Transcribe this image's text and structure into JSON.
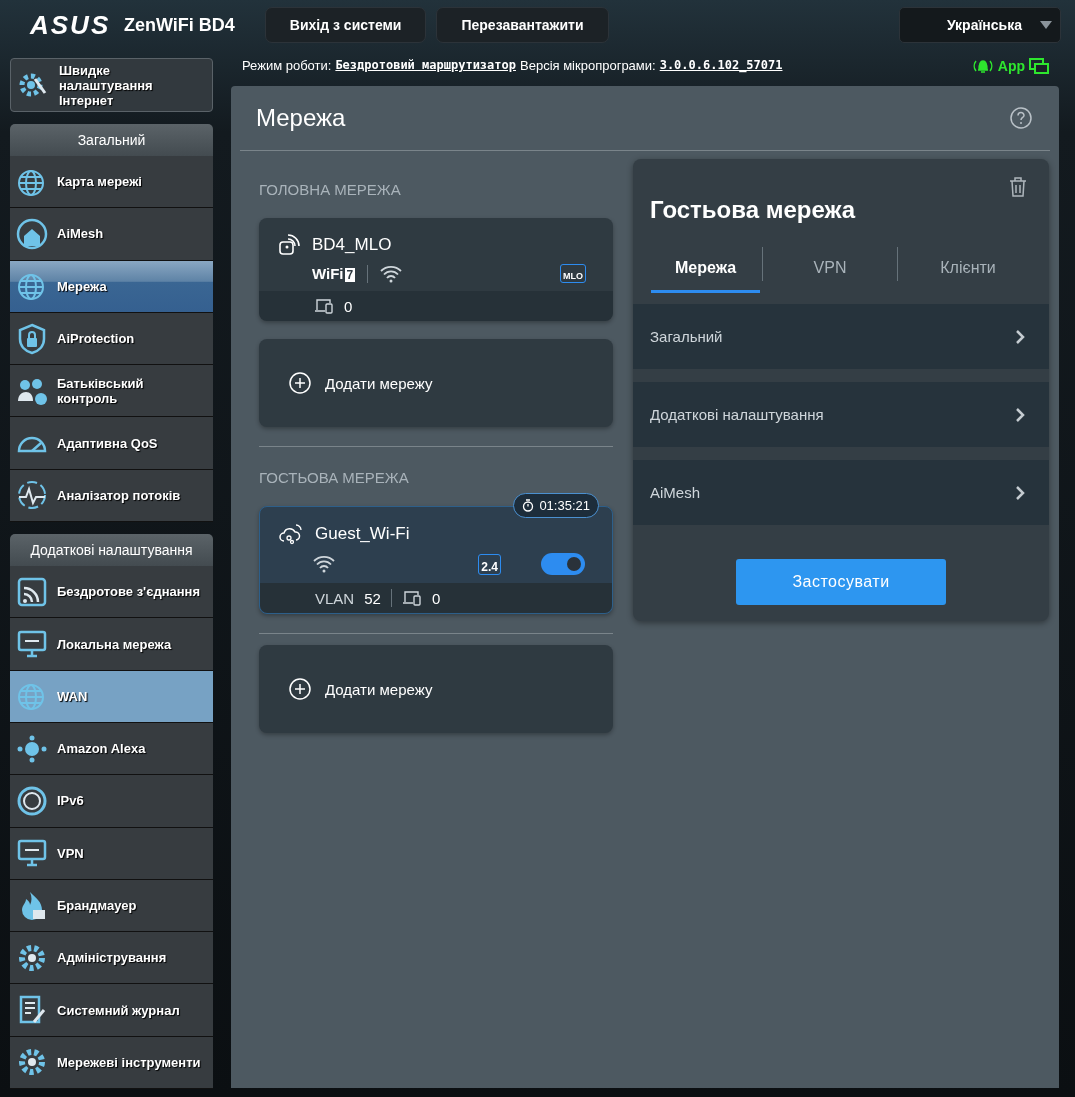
{
  "header": {
    "brand": "ASUS",
    "model": "ZenWiFi BD4",
    "buttons": [
      "Вихід з системи",
      "Перезавантажити"
    ],
    "language": "Українська"
  },
  "status_line": {
    "mode_label": "Режим роботи:",
    "mode": "Бездротовий маршрутизатор",
    "firmware_label": "Версія мікропрограми:",
    "firmware": "3.0.0.6.102_57071",
    "app": "App"
  },
  "sidebar": {
    "quick_setup": "Швидке налаштування Інтернет",
    "sections": [
      {
        "title": "Загальний",
        "items": [
          {
            "label": "Карта мережі",
            "selected": false,
            "hovered": false
          },
          {
            "label": "AiMesh",
            "selected": false,
            "hovered": false
          },
          {
            "label": "Мережа",
            "selected": true,
            "hovered": false
          },
          {
            "label": "AiProtection",
            "selected": false,
            "hovered": false
          },
          {
            "label": "Батьківський контроль",
            "selected": false,
            "hovered": false
          },
          {
            "label": "Адаптивна QoS",
            "selected": false,
            "hovered": false
          },
          {
            "label": "Аналізатор потоків",
            "selected": false,
            "hovered": false
          }
        ]
      },
      {
        "title": "Додаткові налаштування",
        "items": [
          {
            "label": "Бездротове з'єднання",
            "selected": false,
            "hovered": false
          },
          {
            "label": "Локальна мережа",
            "selected": false,
            "hovered": false
          },
          {
            "label": "WAN",
            "selected": false,
            "hovered": true
          },
          {
            "label": "Amazon Alexa",
            "selected": false,
            "hovered": false
          },
          {
            "label": "IPv6",
            "selected": false,
            "hovered": false
          },
          {
            "label": "VPN",
            "selected": false,
            "hovered": false
          },
          {
            "label": "Брандмауер",
            "selected": false,
            "hovered": false
          },
          {
            "label": "Адміністрування",
            "selected": false,
            "hovered": false
          },
          {
            "label": "Системний журнал",
            "selected": false,
            "hovered": false
          },
          {
            "label": "Мережеві інструменти",
            "selected": false,
            "hovered": false
          }
        ]
      }
    ]
  },
  "page": {
    "title": "Мережа",
    "main_network": {
      "heading": "ГОЛОВНА МЕРЕЖА",
      "name": "BD4_MLO",
      "badge_text": "WiFi",
      "badge_number": "7",
      "band": "MLO",
      "clients": "0",
      "add_button": "Додати мережу"
    },
    "guest_network": {
      "heading": "ГОСТЬОВА МЕРЕЖА",
      "name": "Guest_Wi-Fi",
      "timer": "01:35:21",
      "band": "2.4",
      "on": true,
      "vlan_label": "VLAN",
      "vlan": "52",
      "clients": "0",
      "add_button": "Додати мережу"
    },
    "guest_panel": {
      "title": "Гостьова мережа",
      "tabs": [
        {
          "label": "Мережа",
          "selected": true
        },
        {
          "label": "VPN",
          "selected": false
        },
        {
          "label": "Клієнти",
          "selected": false
        }
      ],
      "rows": [
        "Загальний",
        "Додаткові налаштування",
        "AiMesh"
      ],
      "apply_button": "Застосувати"
    }
  }
}
